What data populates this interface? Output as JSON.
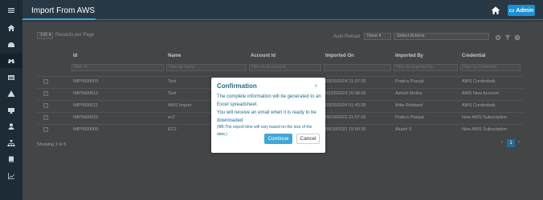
{
  "header": {
    "title": "Import From AWS",
    "admin_label": "Admin"
  },
  "sidebar": {
    "icons": [
      "hamburger-icon",
      "home-icon",
      "dashboard-icon",
      "binoculars-icon",
      "table-icon",
      "warning-icon",
      "monitor-icon",
      "user-icon",
      "sitemap-icon",
      "book-icon",
      "chart-icon"
    ]
  },
  "toolbar": {
    "page_size": "100",
    "records_per_page": "Records per Page",
    "auto_reload": "Auto Reload",
    "auto_reload_value": "None",
    "select_actions": "Select Actions"
  },
  "table": {
    "headers": [
      "Id",
      "Name",
      "Account Id",
      "Imported On",
      "Imported By",
      "Credential"
    ],
    "filter_placeholders": [
      "Filter Id",
      "Filter by Name",
      "Filter by Account Id",
      "",
      "Filter by Imported By",
      "Filter by Credential"
    ],
    "rows": [
      [
        "IMP0000003",
        "Test",
        "",
        "03/25/2024 21:07:25",
        "Pratica Pranjal",
        "AWS Credentials"
      ],
      [
        "IMP0000012",
        "Test",
        "",
        "03/25/2024 20:38:39",
        "Ashish Moitra",
        "AWS New Account"
      ],
      [
        "IMP0000011",
        "AWS Import",
        "",
        "03/25/2024 01:43:28",
        "Mike Robbard",
        "AWS Credentials"
      ],
      [
        "IMP0000010",
        "ec2",
        "",
        "09/19/2022 21:57:32",
        "Pratica Pranjal",
        "New AWS Subscription"
      ],
      [
        "IMP0000009",
        "EC2",
        "",
        "09/19/2022 15:50:30",
        "Akash S",
        "New AWS Subscription"
      ]
    ]
  },
  "footer": {
    "showing": "Showing 1 to 5",
    "prev": "‹",
    "page": "1",
    "next": "›"
  },
  "modal": {
    "title": "Confirmation",
    "close": "×",
    "line1": "The complete information will be generated to an",
    "line2": "Excel spreadsheet.",
    "line3": "You will receive an email when it is ready to be",
    "line4": "downloaded",
    "note1": "(NB:The export time will vary based on the size of the",
    "note2": "data.)",
    "continue": "Continue",
    "cancel": "Cancel"
  }
}
